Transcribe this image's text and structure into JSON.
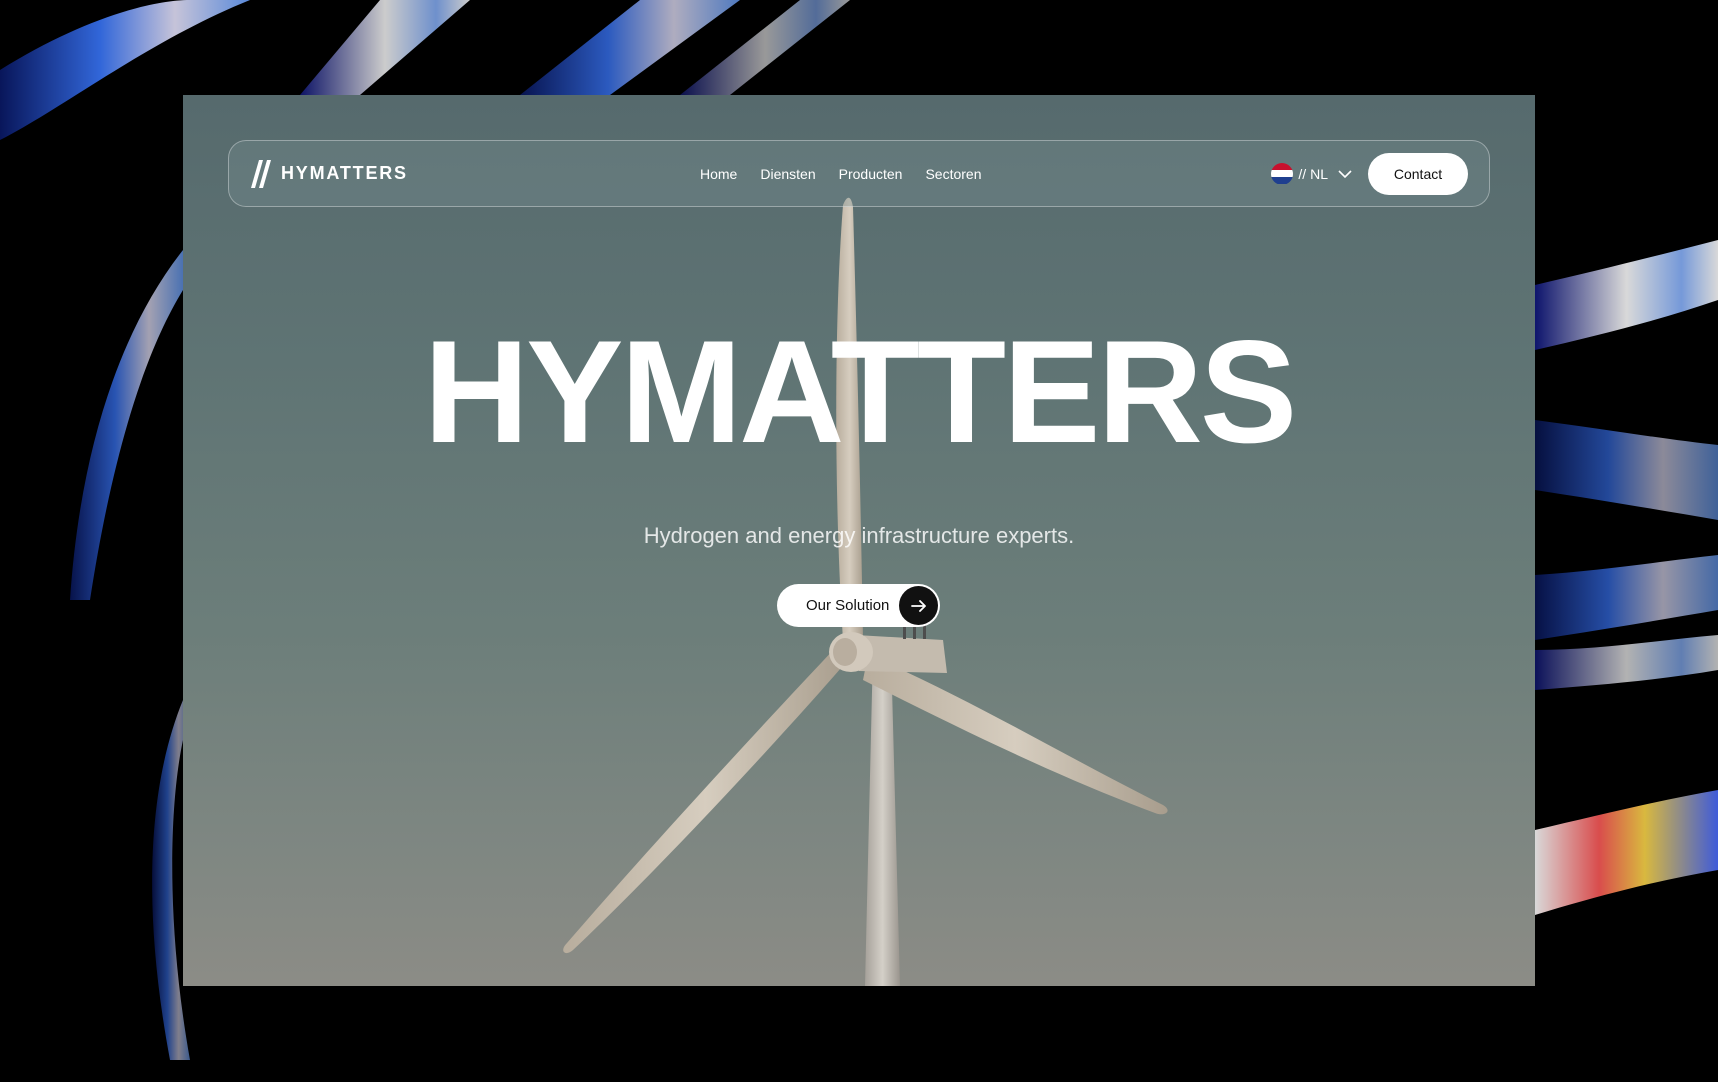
{
  "brand": {
    "name": "HYMATTERS",
    "logo_icon": "double-slash-logo-icon"
  },
  "nav": {
    "items": [
      {
        "label": "Home"
      },
      {
        "label": "Diensten"
      },
      {
        "label": "Producten"
      },
      {
        "label": "Sectoren"
      }
    ],
    "language": {
      "label": "// NL",
      "flag_icon": "netherlands-flag-icon",
      "dropdown_icon": "chevron-down-icon"
    },
    "contact_label": "Contact"
  },
  "hero": {
    "title": "HYMATTERS",
    "subtitle": "Hydrogen and energy infrastructure experts.",
    "cta_label": "Our Solution",
    "cta_icon": "arrow-right-icon",
    "background_image": "wind-turbine-photo"
  },
  "colors": {
    "accent": "#111111",
    "text": "#ffffff",
    "flag_red": "#c8102e",
    "flag_white": "#ffffff",
    "flag_blue": "#1f3f8f"
  }
}
